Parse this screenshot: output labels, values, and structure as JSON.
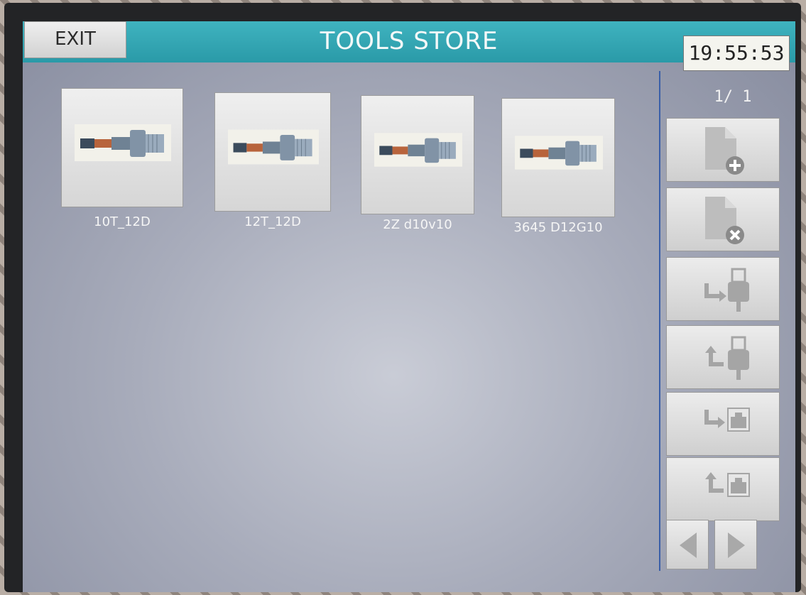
{
  "header": {
    "exit_label": "EXIT",
    "title": "TOOLS STORE",
    "clock": "19:55:53"
  },
  "page_indicator": "1/ 1",
  "tools": [
    {
      "label": "10T_12D",
      "icon": "tool-holder-icon"
    },
    {
      "label": "12T_12D",
      "icon": "tool-holder-icon"
    },
    {
      "label": "2Z d10v10",
      "icon": "tool-holder-icon"
    },
    {
      "label": "3645 D12G10",
      "icon": "tool-holder-icon"
    }
  ],
  "sidebar": {
    "buttons": [
      {
        "name": "add-file",
        "icon": "file-add-icon"
      },
      {
        "name": "delete-file",
        "icon": "file-delete-icon"
      },
      {
        "name": "import-usb",
        "icon": "usb-import-icon"
      },
      {
        "name": "export-usb",
        "icon": "usb-export-icon"
      },
      {
        "name": "import-network",
        "icon": "network-import-icon"
      },
      {
        "name": "export-network",
        "icon": "network-export-icon"
      }
    ],
    "prev_icon": "arrow-left-icon",
    "next_icon": "arrow-right-icon"
  },
  "colors": {
    "title_bar": "#2fa7b4",
    "background": "#a8acbb",
    "divider": "#3a5fa8",
    "icon_gray": "#b4b4b4"
  }
}
